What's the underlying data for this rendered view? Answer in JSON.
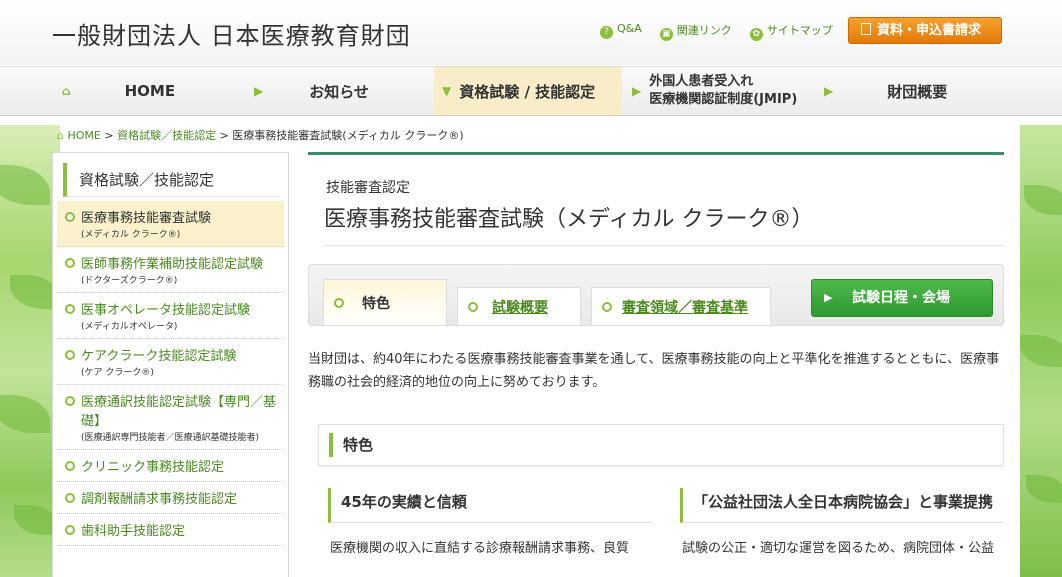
{
  "header": {
    "logo": "一般財団法人 日本医療教育財団",
    "links": [
      {
        "icon": "question-icon",
        "glyph": "?",
        "label": "Q&A"
      },
      {
        "icon": "link-icon",
        "glyph": "▣",
        "label": "関連リンク"
      },
      {
        "icon": "sitemap-icon",
        "glyph": "✿",
        "label": "サイトマップ"
      }
    ],
    "request_button": "資料・申込書請求"
  },
  "nav": {
    "home": "HOME",
    "news": "お知らせ",
    "exam": "資格試験 / 技能認定",
    "jmip_line1": "外国人患者受入れ",
    "jmip_line2": "医療機関認証制度(JMIP)",
    "about": "財団概要"
  },
  "breadcrumb": {
    "home": "HOME",
    "sep": ">",
    "level1": "資格試験／技能認定",
    "current": "医療事務技能審査試験(メディカル クラーク®)"
  },
  "sidebar": {
    "title": "資格試験／技能認定",
    "items": [
      {
        "label": "医療事務技能審査試験",
        "sub": "(メディカル クラーク®)"
      },
      {
        "label": "医師事務作業補助技能認定試験",
        "sub": "(ドクターズクラーク®)"
      },
      {
        "label": "医事オペレータ技能認定試験",
        "sub": "(メディカルオペレータ)"
      },
      {
        "label": "ケアクラーク技能認定試験",
        "sub": "(ケア クラーク®)"
      },
      {
        "label": "医療通訳技能認定試験【専門／基礎】",
        "sub": "(医療通訳専門技能者／医療通訳基礎技能者)"
      },
      {
        "label": "クリニック事務技能認定",
        "sub": ""
      },
      {
        "label": "調剤報酬請求事務技能認定",
        "sub": ""
      },
      {
        "label": "歯科助手技能認定",
        "sub": ""
      }
    ]
  },
  "main": {
    "category": "技能審査認定",
    "title": "医療事務技能審査試験（メディカル クラーク®）",
    "tabs": [
      "特色",
      "試験概要",
      "審査領域／審査基準"
    ],
    "schedule_button": "試験日程・会場",
    "intro": "当財団は、約40年にわたる医療事務技能審査事業を通して、医療事務技能の向上と平準化を推進するとともに、医療事務職の社会的経済的地位の向上に努めております。",
    "section_title": "特色",
    "col1_title": "45年の実績と信頼",
    "col1_text": "医療機関の収入に直結する診療報酬請求事務、良質",
    "col2_title": "「公益社団法人全日本病院協会」と事業提携",
    "col2_text": "試験の公正・適切な運営を図るため、病院団体・公益"
  },
  "colors": {
    "accent_green": "#8cbd3c",
    "orange": "#e8870f",
    "teal": "#3b8a68",
    "button_green": "#2f9a32",
    "highlight": "#fbf1cc"
  }
}
